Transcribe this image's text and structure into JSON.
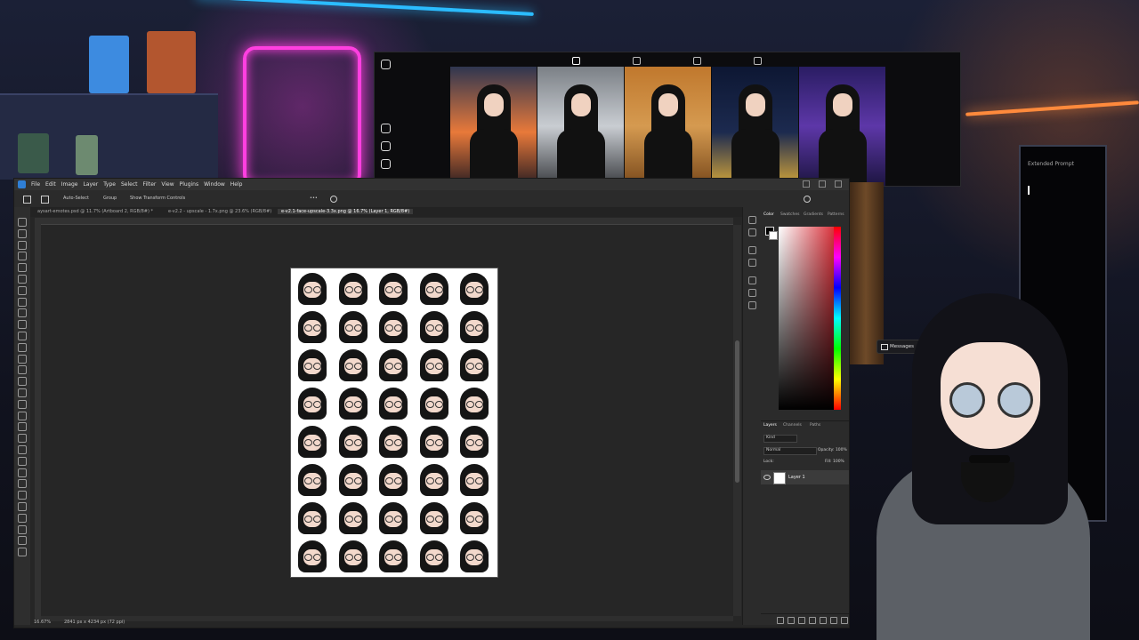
{
  "instagram": {
    "logo_icon": "instagram-icon",
    "side_icons": [
      "home-icon",
      "reels-icon",
      "send-icon"
    ],
    "tab_icons": [
      "grid-icon",
      "reels-icon",
      "saved-icon",
      "tagged-icon"
    ],
    "photos": [
      {
        "bg": "linear-gradient(180deg,#2f3650 0%,#e8793a 55%,#2b1e22 100%)"
      },
      {
        "bg": "linear-gradient(180deg,#7b8086 0%,#c9cdd2 50%,#3a3c40 100%)"
      },
      {
        "bg": "linear-gradient(180deg,#c0782d 0%,#d59a50 50%,#7a4a1c 100%)"
      },
      {
        "bg": "linear-gradient(180deg,#0d1733 0%,#1c2a4f 55%,#d3a53a 100%)"
      },
      {
        "bg": "linear-gradient(180deg,#2a1d63 0%,#5d37a8 50%,#1c1540 100%)"
      }
    ]
  },
  "photoshop": {
    "menu": [
      "File",
      "Edit",
      "Image",
      "Layer",
      "Type",
      "Select",
      "Filter",
      "View",
      "Plugins",
      "Window",
      "Help"
    ],
    "options": {
      "auto_select": "Auto-Select",
      "group": "Group",
      "transform": "Show Transform Controls"
    },
    "doc_tabs": [
      "aysart-emotes.psd @ 11.7% (Artboard 2, RGB/8#) *",
      "e-v2.2 - upscale - 1.7x.png @ 23.6% (RGB/8#)",
      "e-v2.1-face-upscale-3.3x.png @ 16.7% (Layer 1, RGB/8#)"
    ],
    "status": {
      "zoom": "16.67%",
      "dims": "2841 px x 4234 px (72 ppi)"
    },
    "color_panel": {
      "tabs": [
        "Color",
        "Swatches",
        "Gradients",
        "Patterns"
      ]
    },
    "layers_panel": {
      "tabs": [
        "Layers",
        "Channels",
        "Paths"
      ],
      "kind": "Kind",
      "blend_mode": "Normal",
      "opacity_label": "Opacity:",
      "opacity_value": "100%",
      "lock_label": "Lock:",
      "fill_label": "Fill:",
      "fill_value": "100%",
      "layer_name": "Layer 1"
    }
  },
  "messages": {
    "label": "Messages"
  },
  "terminal": {
    "title": "Extended Prompt"
  }
}
